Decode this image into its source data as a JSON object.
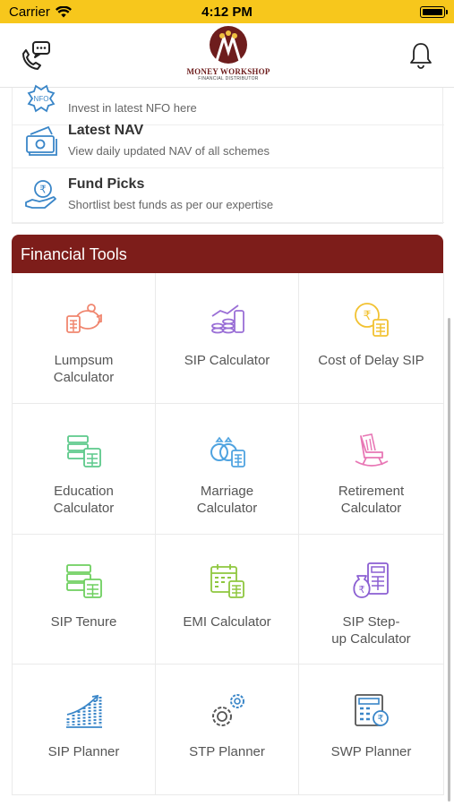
{
  "status_bar": {
    "carrier": "Carrier",
    "time": "4:12 PM"
  },
  "header": {
    "logo_title": "MONEY WORKSHOP",
    "logo_subtitle": "FINANCIAL DISTRIBUTOR",
    "icons": [
      "phone-chat-icon",
      "bell-icon"
    ]
  },
  "menu": [
    {
      "icon": "nfo-icon",
      "title": "",
      "subtitle": "Invest in latest NFO here"
    },
    {
      "icon": "money-notes-icon",
      "title": "Latest NAV",
      "subtitle": "View daily updated NAV of all schemes"
    },
    {
      "icon": "rupee-hand-icon",
      "title": "Fund Picks",
      "subtitle": "Shortlist best funds as per our expertise"
    }
  ],
  "tools": {
    "title": "Financial Tools",
    "items": [
      {
        "label": "Lumpsum\nCalculator",
        "icon": "piggy-bank-calculator-icon",
        "color": "#f0866f"
      },
      {
        "label": "SIP Calculator",
        "icon": "coins-chart-icon",
        "color": "#9a6fd6"
      },
      {
        "label": "Cost of Delay SIP",
        "icon": "rupee-clock-calculator-icon",
        "color": "#f2c232"
      },
      {
        "label": "Education\nCalculator",
        "icon": "books-calculator-icon",
        "color": "#5cc98b"
      },
      {
        "label": "Marriage\nCalculator",
        "icon": "rings-calculator-icon",
        "color": "#4fa3e0"
      },
      {
        "label": "Retirement\nCalculator",
        "icon": "rocking-chair-icon",
        "color": "#e877b5"
      },
      {
        "label": "SIP Tenure",
        "icon": "tenure-calculator-icon",
        "color": "#6ecf5f"
      },
      {
        "label": "EMI Calculator",
        "icon": "calendar-calculator-icon",
        "color": "#8fc73f"
      },
      {
        "label": "SIP Step-\nup Calculator",
        "icon": "money-bag-calculator-icon",
        "color": "#8b5fd2"
      },
      {
        "label": "SIP Planner",
        "icon": "bar-growth-icon",
        "color": "#3a86c8"
      },
      {
        "label": "STP Planner",
        "icon": "gears-icon",
        "color": "#3a86c8"
      },
      {
        "label": "SWP Planner",
        "icon": "rupee-calculator-icon",
        "color": "#3a86c8"
      }
    ]
  }
}
